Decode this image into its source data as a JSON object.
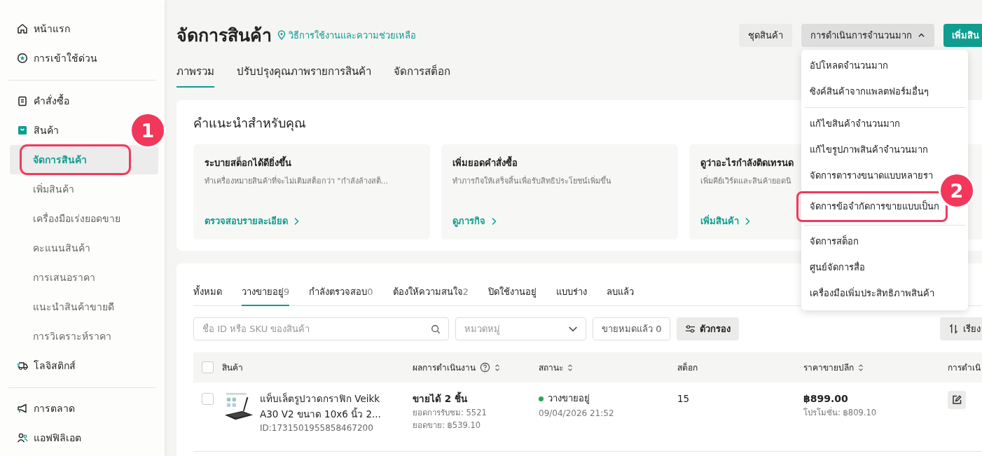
{
  "sidebar": {
    "sections": [
      {
        "items": [
          {
            "label": "หน้าแรก",
            "selected": false
          },
          {
            "label": "การเข้าใช้ด่วน",
            "selected": false
          }
        ]
      },
      {
        "items": [
          {
            "label": "คำสั่งซื้อ",
            "selected": false
          },
          {
            "label": "สินค้า",
            "selected": false,
            "expanded": true,
            "children": [
              {
                "label": "จัดการสินค้า",
                "selected": true,
                "highlight_badge": "1"
              },
              {
                "label": "เพิ่มสินค้า",
                "selected": false
              },
              {
                "label": "เครื่องมือเร่งยอดขาย",
                "selected": false
              },
              {
                "label": "คะแนนสินค้า",
                "selected": false
              },
              {
                "label": "การเสนอราคา",
                "selected": false
              },
              {
                "label": "แนะนำสินค้าขายดี",
                "selected": false
              },
              {
                "label": "การวิเคราะห์ราคา",
                "selected": false
              }
            ]
          },
          {
            "label": "โลจิสติกส์",
            "selected": false
          }
        ]
      },
      {
        "items": [
          {
            "label": "การตลาด",
            "selected": false
          },
          {
            "label": "แอฟฟิลิเอต",
            "selected": false
          }
        ]
      }
    ]
  },
  "header": {
    "title": "จัดการสินค้า",
    "help_link": "วิธีการใช้งานและความช่วยเหลือ",
    "buttons": [
      {
        "label": "ชุดสินค้า",
        "kind": "secondary"
      },
      {
        "label": "การดำเนินการจำนวนมาก",
        "kind": "dropdown",
        "expanded": true
      },
      {
        "label": "เพิ่มสิน",
        "kind": "primary"
      }
    ]
  },
  "tabs": [
    {
      "label": "ภาพรวม",
      "selected": true
    },
    {
      "label": "ปรับปรุงคุณภาพรายการสินค้า",
      "selected": false
    },
    {
      "label": "จัดการสต็อก",
      "selected": false
    }
  ],
  "bulk_menu": {
    "groups": [
      [
        {
          "label": "อัปโหลดจำนวนมาก"
        },
        {
          "label": "ซิงค์สินค้าจากแพลตฟอร์มอื่นๆ"
        }
      ],
      [
        {
          "label": "แก้ไขสินค้าจำนวนมาก"
        },
        {
          "label": "แก้ไขรูปภาพสินค้าจำนวนมาก"
        },
        {
          "label": "จัดการตารางขนาดแบบหลายรา"
        },
        {
          "label": "จัดการข้อจำกัดการขายแบบเป็นก",
          "highlight_badge": "2"
        }
      ],
      [
        {
          "label": "จัดการสต็อก"
        },
        {
          "label": "ศูนย์จัดการสื่อ"
        },
        {
          "label": "เครื่องมือเพิ่มประสิทธิภาพสินค้า"
        }
      ]
    ]
  },
  "recommendations": {
    "title": "คำแนะนำสำหรับคุณ",
    "cards": [
      {
        "title": "ระบายสต็อกได้ดียิ่งขึ้น",
        "text": "ทำเครื่องหมายสินค้าที่จะไม่เติมสต็อกว่า \"กำลังล้างสต็...",
        "link": "ตรวจสอบรายละเอียด"
      },
      {
        "title": "เพิ่มยอดคำสั่งซื้อ",
        "text": "ทำภารกิจให้เสร็จสิ้นเพื่อรับสิทธิประโยชน์เพิ่มขึ้น",
        "link": "ดูภารกิจ"
      },
      {
        "title": "ดูว่าอะไรกำลังติดเทรนด",
        "text": "เพิ่มคีย์เวิร์ดและสินค้ายอดนิ",
        "link": "เพิ่มสินค้า"
      }
    ]
  },
  "products": {
    "tabs": [
      {
        "label": "ทั้งหมด",
        "selected": false
      },
      {
        "label": "วางขายอยู่",
        "count": "9",
        "selected": true
      },
      {
        "label": "กำลังตรวจสอบ",
        "count": "0",
        "selected": false
      },
      {
        "label": "ต้องให้ความสนใจ",
        "count": "2",
        "selected": false
      },
      {
        "label": "ปิดใช้งานอยู่",
        "selected": false
      },
      {
        "label": "แบบร่าง",
        "selected": false
      },
      {
        "label": "ลบแล้ว",
        "selected": false
      }
    ],
    "search": {
      "placeholder": "ชื่อ ID หรือ SKU ของสินค้า"
    },
    "category": {
      "placeholder": "หมวดหมู่"
    },
    "sold_out_button": "ขายหมดแล้ว 0",
    "filter_button": "ตัวกรอง",
    "sort_button": "เรียง",
    "table": {
      "select_all_checked": false,
      "columns": [
        {
          "label": "สินค้า",
          "sortable": false,
          "help": false
        },
        {
          "label": "ผลการดำเนินงาน",
          "sortable": true,
          "help": true
        },
        {
          "label": "สถานะ",
          "sortable": true,
          "help": false
        },
        {
          "label": "สต็อก",
          "sortable": false,
          "help": false
        },
        {
          "label": "ราคาขายปลีก",
          "sortable": true,
          "help": false
        },
        {
          "label": "การดำเนิ"
        }
      ],
      "rows": [
        {
          "checked": false,
          "name": "แท็บเล็ตรูปวาดกราฟิก Veikk A30 V2 ขนาด 10x6 นิ้ว 2...",
          "id": "ID:1731501955858467200",
          "sales": "ขายได้ 2 ชิ้น",
          "views": "ยอดการรับชม: 5521",
          "revenue": "ยอดขาย: ฿539.10",
          "status": "วางขายอยู่",
          "color": "#1faa59",
          "updated": "09/04/2026 21:52",
          "stock": "15",
          "price": "฿899.00",
          "promo_price": "โปรโมชั่น: ฿809.10"
        }
      ]
    }
  }
}
